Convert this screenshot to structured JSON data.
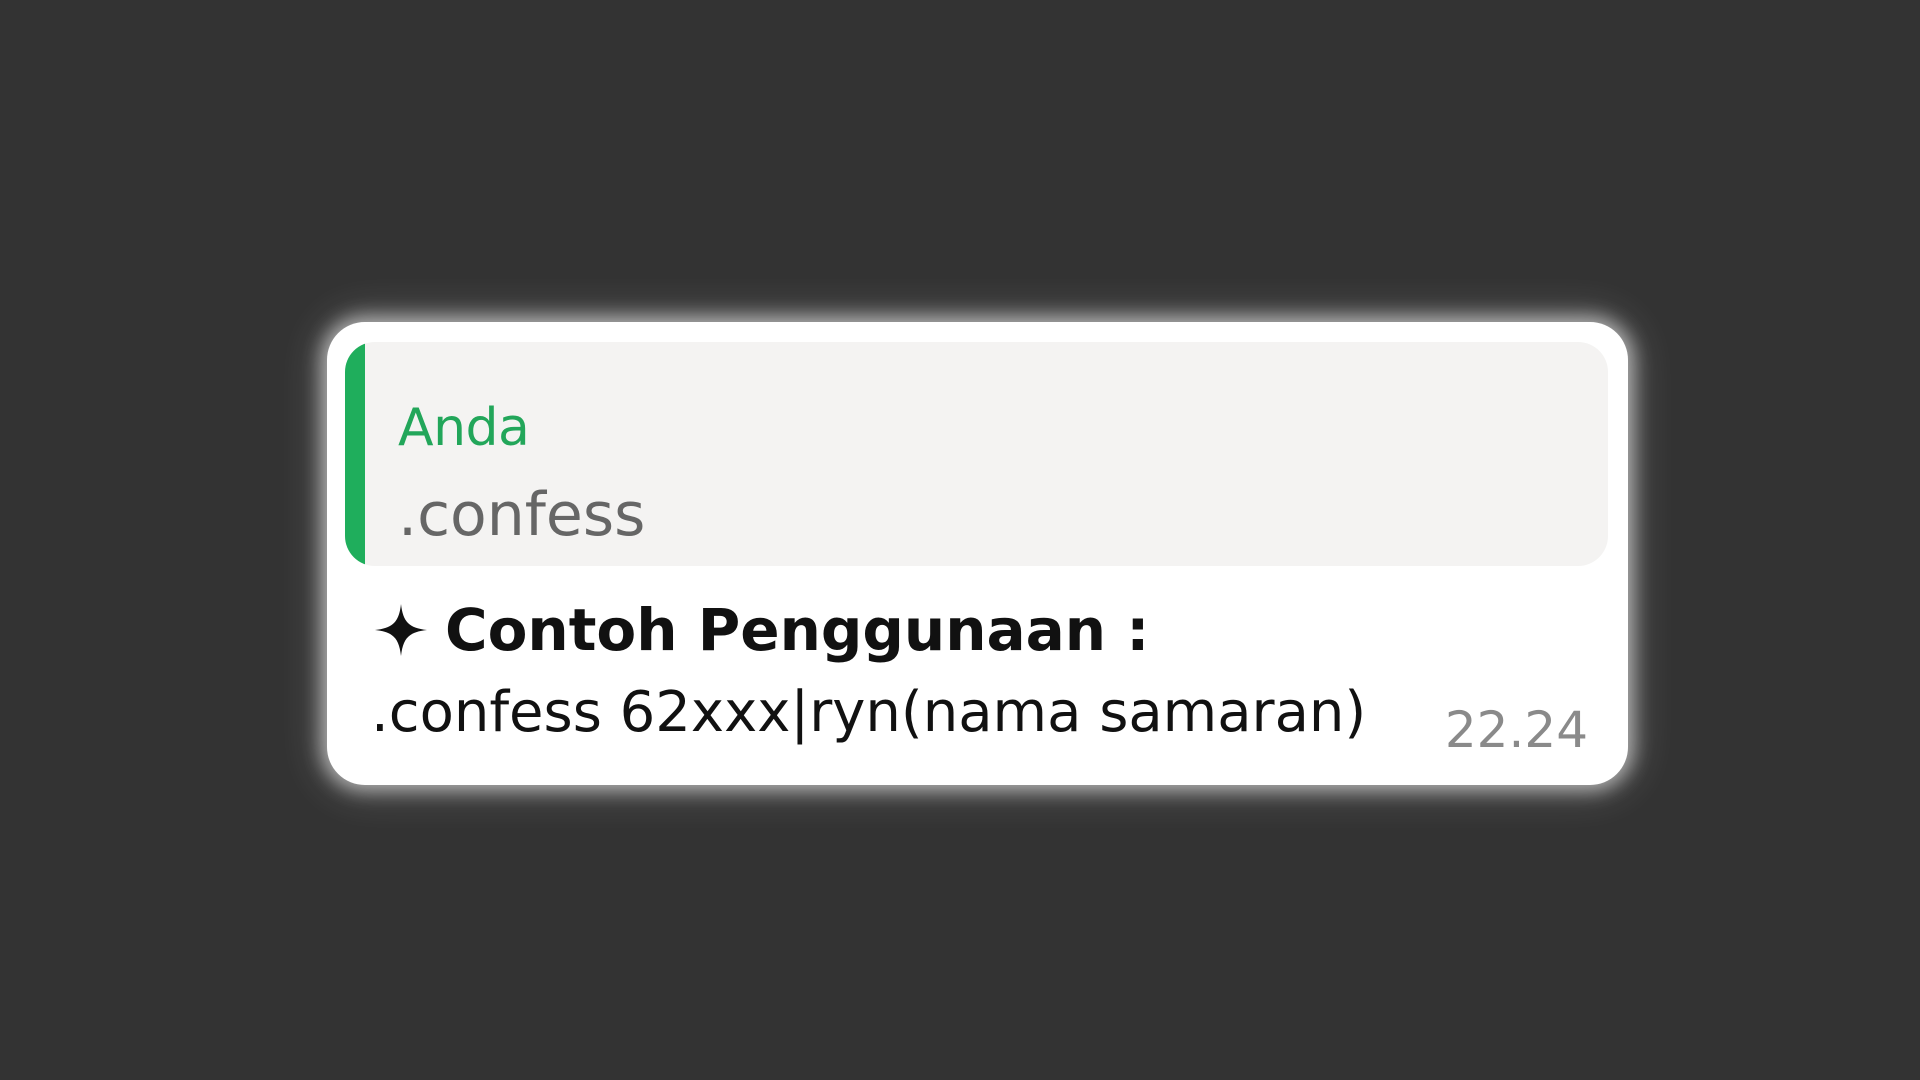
{
  "message": {
    "quote": {
      "author": "Anda",
      "text": ".confess"
    },
    "heading": {
      "icon": "sparkle-icon",
      "text": "Contoh Penggunaan :"
    },
    "body": ".confess 62xxx|ryn(nama samaran)",
    "timestamp": "22.24"
  },
  "colors": {
    "background": "#333333",
    "bubble": "#ffffff",
    "quote_background": "#f4f3f2",
    "accent_green": "#1fae5c",
    "timestamp_gray": "#8a8a8a"
  }
}
